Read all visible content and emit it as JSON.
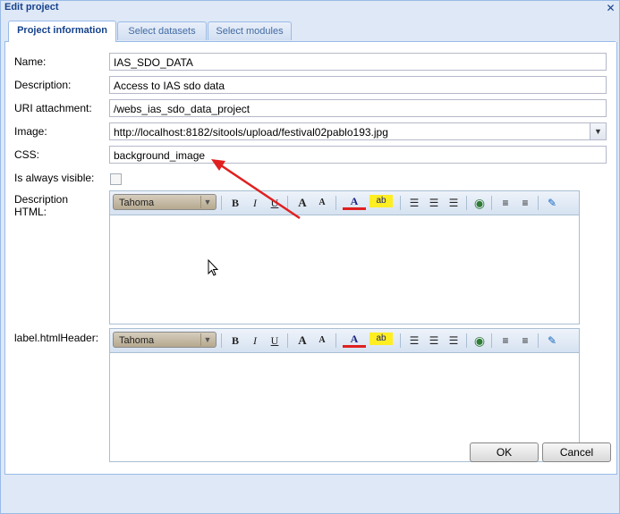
{
  "window": {
    "title": "Edit project",
    "close_icon": "close-icon"
  },
  "tabs": [
    {
      "label": "Project information",
      "active": true
    },
    {
      "label": "Select datasets",
      "active": false
    },
    {
      "label": "Select modules",
      "active": false
    }
  ],
  "form": {
    "name": {
      "label": "Name:",
      "value": "IAS_SDO_DATA"
    },
    "description": {
      "label": "Description:",
      "value": "Access to IAS sdo data"
    },
    "uri": {
      "label": "URI attachment:",
      "value": "/webs_ias_sdo_data_project"
    },
    "image": {
      "label": "Image:",
      "value": "http://localhost:8182/sitools/upload/festival02pablo193.jpg"
    },
    "css": {
      "label": "CSS:",
      "value": "background_image"
    },
    "visible": {
      "label": "Is always visible:",
      "checked": false
    },
    "description_html": {
      "label_line1": "Description",
      "label_line2": "HTML:"
    },
    "html_header": {
      "label": "label.htmlHeader:"
    }
  },
  "editor_toolbar": {
    "font": "Tahoma",
    "bold": "B",
    "italic": "I",
    "underline": "U",
    "grow": "A",
    "shrink": "A",
    "fore_color": "A",
    "highlight": "ab"
  },
  "buttons": {
    "ok": "OK",
    "cancel": "Cancel"
  },
  "colors": {
    "arrow": "#e02020",
    "accent": "#15428b",
    "border": "#99bbe8"
  }
}
